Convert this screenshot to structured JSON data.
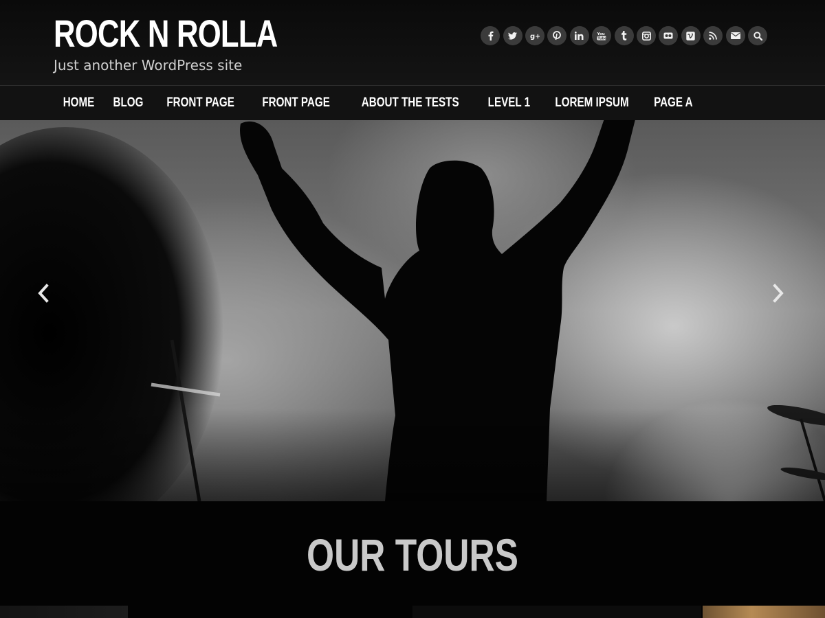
{
  "site": {
    "title": "ROCK N ROLLA",
    "tagline": "Just another WordPress site"
  },
  "social": [
    {
      "icon": "facebook-icon",
      "glyph": "f"
    },
    {
      "icon": "twitter-icon",
      "glyph": "t"
    },
    {
      "icon": "google-plus-icon",
      "glyph": "g+"
    },
    {
      "icon": "pinterest-icon",
      "glyph": "p"
    },
    {
      "icon": "linkedin-icon",
      "glyph": "in"
    },
    {
      "icon": "youtube-icon",
      "glyph": "You"
    },
    {
      "icon": "tumblr-icon",
      "glyph": "t"
    },
    {
      "icon": "instagram-icon",
      "glyph": "ig"
    },
    {
      "icon": "flickr-icon",
      "glyph": "••"
    },
    {
      "icon": "vimeo-icon",
      "glyph": "v"
    },
    {
      "icon": "rss-icon",
      "glyph": "rss"
    },
    {
      "icon": "envelope-icon",
      "glyph": "mail"
    },
    {
      "icon": "search-icon",
      "glyph": "search"
    }
  ],
  "nav": {
    "items": [
      "HOME",
      "BLOG",
      "FRONT PAGE",
      "FRONT PAGE",
      "ABOUT THE TESTS",
      "LEVEL 1",
      "LOREM IPSUM",
      "PAGE A"
    ]
  },
  "slider": {
    "prev_icon": "chevron-left-icon",
    "next_icon": "chevron-right-icon"
  },
  "tours": {
    "title": "OUR TOURS"
  },
  "colors": {
    "header_bg": "#0a0a0a",
    "social_bg": "#3b3b3b",
    "tours_title": "#c9c9c9"
  }
}
